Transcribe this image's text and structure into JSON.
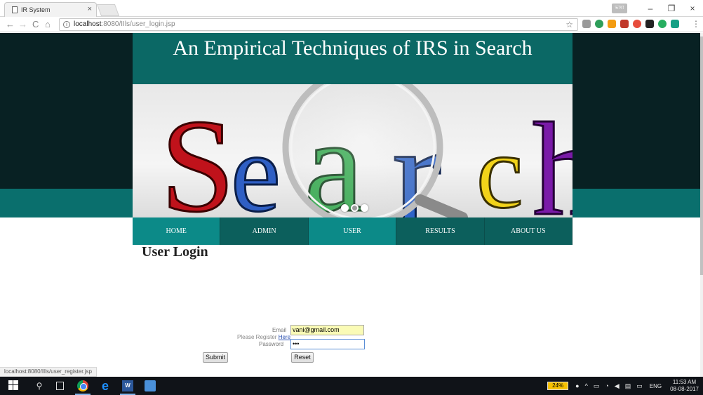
{
  "browser": {
    "tab_title": "IR System",
    "tab_close": "×",
    "user_badge": "ভাষা",
    "window_minimize": "–",
    "window_restore": "❐",
    "window_close": "×",
    "back": "←",
    "forward": "→",
    "reload": "C",
    "home": "⌂",
    "url_host": "localhost",
    "url_path": ":8080/IIls/user_login.jsp",
    "bookmark_star": "☆",
    "menu": "⋮"
  },
  "site": {
    "title": "An Empirical Techniques of IRS in Search",
    "banner_word": "Search",
    "nav": [
      {
        "label": "HOME"
      },
      {
        "label": "ADMIN"
      },
      {
        "label": "USER"
      },
      {
        "label": "RESULTS"
      },
      {
        "label": "ABOUT US"
      }
    ]
  },
  "login": {
    "heading": "User Login",
    "email_label": "Email",
    "email_value": "vani@gmail.com",
    "password_label": "Password",
    "password_value": "•••",
    "submit_label": "Submit",
    "reset_label": "Reset",
    "register_prefix": "Please Register ",
    "register_link": "Here"
  },
  "status_bar": {
    "url": "localhost:8080/IIls/user_register.jsp"
  },
  "taskbar": {
    "battery": "24%",
    "language": "ENG",
    "time": "11:53 AM",
    "date": "08-08-2017"
  },
  "colors": {
    "header_teal": "#0b6865",
    "nav_teal": "#0c8a88",
    "nav_dark": "#0c5f5c",
    "page_dark_band": "#082123"
  }
}
